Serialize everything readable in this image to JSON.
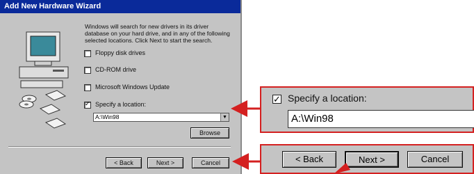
{
  "window": {
    "title": "Add New Hardware Wizard",
    "intro": "Windows will search for new drivers in its driver database on your hard drive, and in any of the following selected locations. Click Next to start the search.",
    "options": [
      {
        "label": "Floppy disk drives",
        "checked": false
      },
      {
        "label": "CD-ROM drive",
        "checked": false
      },
      {
        "label": "Microsoft Windows Update",
        "checked": false
      },
      {
        "label": "Specify a location:",
        "checked": true
      }
    ],
    "location_value": "A:\\Win98",
    "browse_label": "Browse",
    "back_label": "< Back",
    "next_label": "Next >",
    "cancel_label": "Cancel"
  },
  "callout_location": {
    "label": "Specify a location:",
    "checked": true,
    "value": "A:\\Win98"
  },
  "callout_buttons": {
    "back_label": "< Back",
    "next_label": "Next >",
    "cancel_label": "Cancel"
  },
  "colors": {
    "titlebar": "#0a2a9a",
    "dialog_bg": "#c4c4c4",
    "callout_border": "#d42020",
    "arrow": "#d42020"
  },
  "icons": {
    "wizard_art": "computer-with-discs-icon",
    "dropdown_arrow": "chevron-down-icon",
    "check": "check-icon"
  }
}
